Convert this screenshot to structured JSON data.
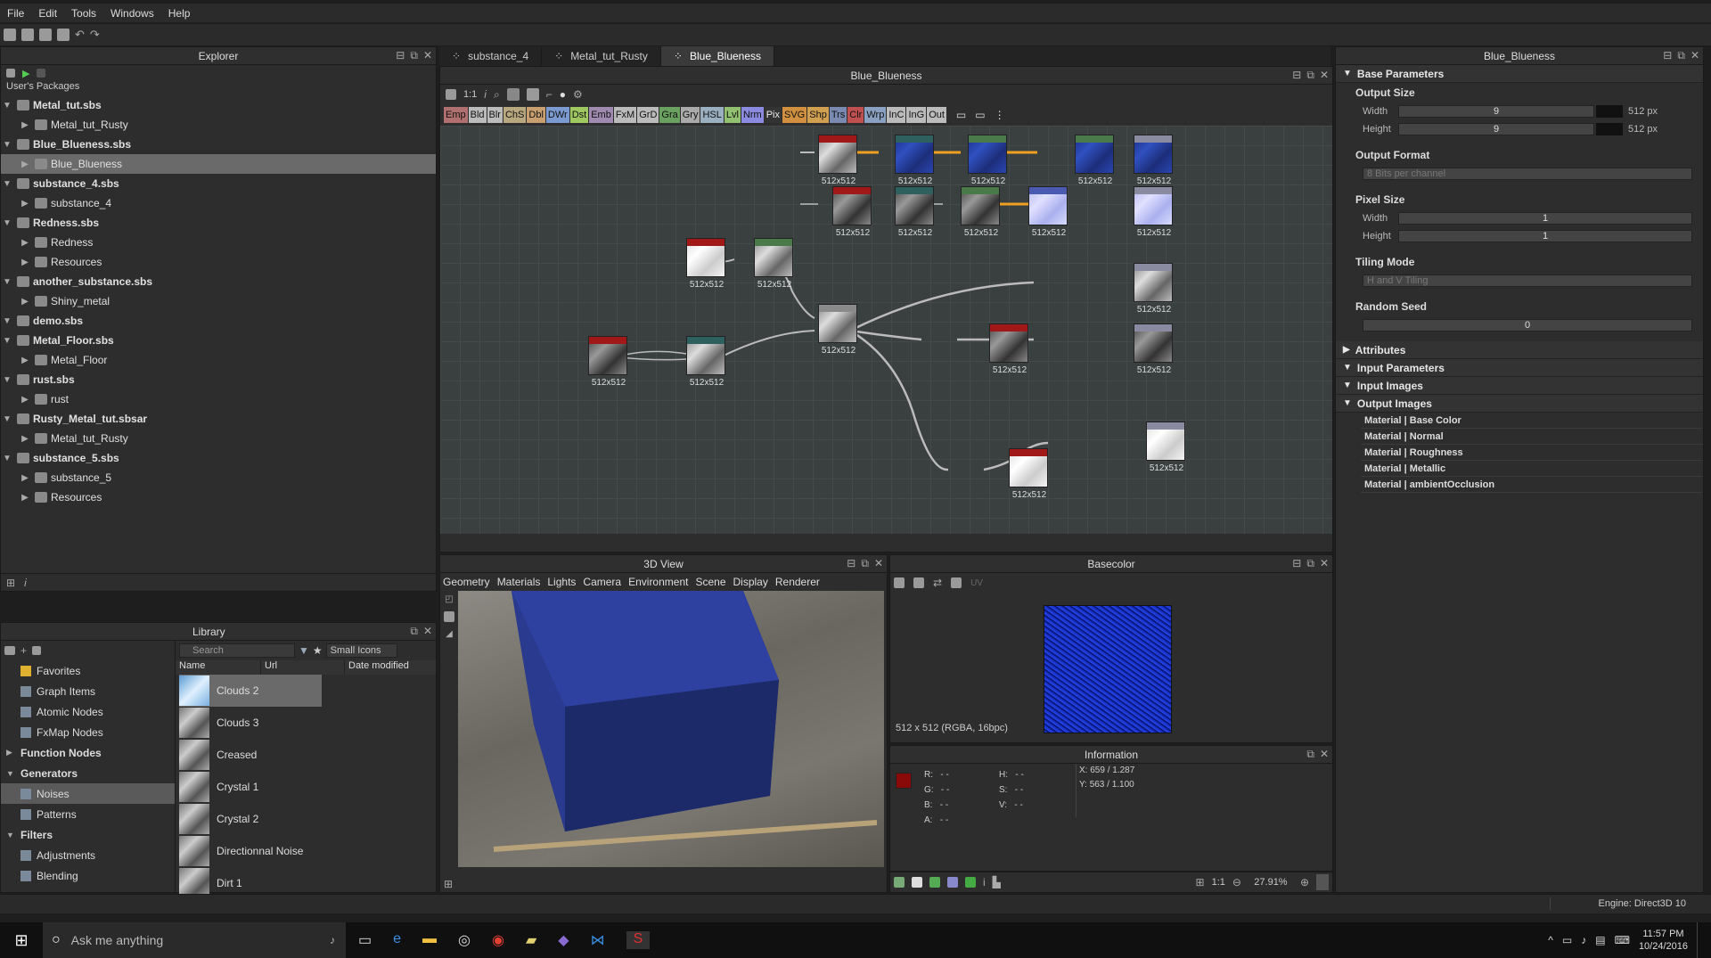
{
  "menu": [
    "File",
    "Edit",
    "Tools",
    "Windows",
    "Help"
  ],
  "explorer": {
    "title": "Explorer",
    "section": "User's Packages",
    "items": [
      {
        "label": "Metal_tut.sbs",
        "level": 1,
        "pkg": true
      },
      {
        "label": "Metal_tut_Rusty",
        "level": 2
      },
      {
        "label": "Blue_Blueness.sbs",
        "level": 1,
        "pkg": true
      },
      {
        "label": "Blue_Blueness",
        "level": 2,
        "selected": true
      },
      {
        "label": "substance_4.sbs",
        "level": 1,
        "pkg": true
      },
      {
        "label": "substance_4",
        "level": 2
      },
      {
        "label": "Redness.sbs",
        "level": 1,
        "pkg": true
      },
      {
        "label": "Redness",
        "level": 2
      },
      {
        "label": "Resources",
        "level": 2
      },
      {
        "label": "another_substance.sbs",
        "level": 1,
        "pkg": true
      },
      {
        "label": "Shiny_metal",
        "level": 2
      },
      {
        "label": "demo.sbs",
        "level": 1,
        "pkg": true
      },
      {
        "label": "Metal_Floor.sbs",
        "level": 1,
        "pkg": true
      },
      {
        "label": "Metal_Floor",
        "level": 2
      },
      {
        "label": "rust.sbs",
        "level": 1,
        "pkg": true
      },
      {
        "label": "rust",
        "level": 2
      },
      {
        "label": "Rusty_Metal_tut.sbsar",
        "level": 1,
        "pkg": true
      },
      {
        "label": "Metal_tut_Rusty",
        "level": 2
      },
      {
        "label": "substance_5.sbs",
        "level": 1,
        "pkg": true
      },
      {
        "label": "substance_5",
        "level": 2
      },
      {
        "label": "Resources",
        "level": 2
      }
    ]
  },
  "tabs": [
    "substance_4",
    "Metal_tut_Rusty",
    "Blue_Blueness"
  ],
  "graph": {
    "title": "Blue_Blueness",
    "zoom": "1:1",
    "filters": [
      "Emp",
      "Bld",
      "Blr",
      "ChS",
      "Dbl",
      "DWr",
      "Dst",
      "Emb",
      "FxM",
      "GrD",
      "Gra",
      "Gry",
      "HSL",
      "Lvl",
      "Nrm",
      "Pix",
      "SVG",
      "Shp",
      "Trs",
      "Clr",
      "Wrp",
      "InC",
      "InG",
      "Out"
    ],
    "node_label": "512x512"
  },
  "params": {
    "title": "Blue_Blueness",
    "base_parameters": "Base Parameters",
    "output_size": "Output Size",
    "width_label": "Width",
    "height_label": "Height",
    "width_val": "9",
    "height_val": "9",
    "px_unit": "512 px",
    "output_format": "Output Format",
    "output_format_val": "8 Bits per channel",
    "pixel_size": "Pixel Size",
    "pixel_w": "1",
    "pixel_h": "1",
    "tiling_mode": "Tiling Mode",
    "tiling_val": "H and V Tiling",
    "random_seed": "Random Seed",
    "seed_val": "0",
    "attributes": "Attributes",
    "input_parameters": "Input Parameters",
    "input_images": "Input Images",
    "output_images": "Output Images",
    "outputs": [
      "Material | Base Color",
      "Material | Normal",
      "Material | Roughness",
      "Material | Metallic",
      "Material | ambientOcclusion"
    ]
  },
  "view3d": {
    "title": "3D View",
    "menu": [
      "Geometry",
      "Materials",
      "Lights",
      "Camera",
      "Environment",
      "Scene",
      "Display",
      "Renderer"
    ]
  },
  "basecolor": {
    "title": "Basecolor",
    "uv": "UV",
    "info": "512 x 512 (RGBA, 16bpc)",
    "zoom": "1:1",
    "percent": "27.91%"
  },
  "information": {
    "title": "Information",
    "r": "R:",
    "g": "G:",
    "b": "B:",
    "a": "A:",
    "h": "H:",
    "s": "S:",
    "v": "V:",
    "dash": "- -",
    "x_label": "X:",
    "x_val": "659 / 1.287",
    "y_label": "Y:",
    "y_val": "563 / 1.100"
  },
  "library": {
    "title": "Library",
    "search_placeholder": "Search",
    "view_mode": "Small Icons",
    "cols": [
      "Name",
      "Url",
      "Date modified"
    ],
    "left": [
      {
        "label": "Favorites",
        "bold": false,
        "arrow": ""
      },
      {
        "label": "Graph Items",
        "bold": false,
        "arrow": ""
      },
      {
        "label": "Atomic Nodes",
        "bold": false,
        "arrow": ""
      },
      {
        "label": "FxMap Nodes",
        "bold": false,
        "arrow": ""
      },
      {
        "label": "Function Nodes",
        "bold": true,
        "arrow": "▶"
      },
      {
        "label": "Generators",
        "bold": true,
        "arrow": "▼"
      },
      {
        "label": "Noises",
        "bold": false,
        "arrow": "",
        "sel": true
      },
      {
        "label": "Patterns",
        "bold": false,
        "arrow": ""
      },
      {
        "label": "Filters",
        "bold": true,
        "arrow": "▼"
      },
      {
        "label": "Adjustments",
        "bold": false,
        "arrow": ""
      },
      {
        "label": "Blending",
        "bold": false,
        "arrow": ""
      }
    ],
    "items": [
      "Clouds 2",
      "Clouds 3",
      "Creased",
      "Crystal 1",
      "Crystal 2",
      "Directionnal Noise",
      "Dirt 1"
    ]
  },
  "status": {
    "engine": "Engine: Direct3D 10"
  },
  "taskbar": {
    "search": "Ask me anything",
    "time": "11:57 PM",
    "date": "10/24/2016"
  },
  "colors": {
    "accent": "#f0a020",
    "node_red": "#a01818",
    "node_green": "#4a7a4a",
    "node_teal": "#2e6060",
    "node_blue": "#4a5ab0",
    "node_grey": "#8a8aa0"
  }
}
